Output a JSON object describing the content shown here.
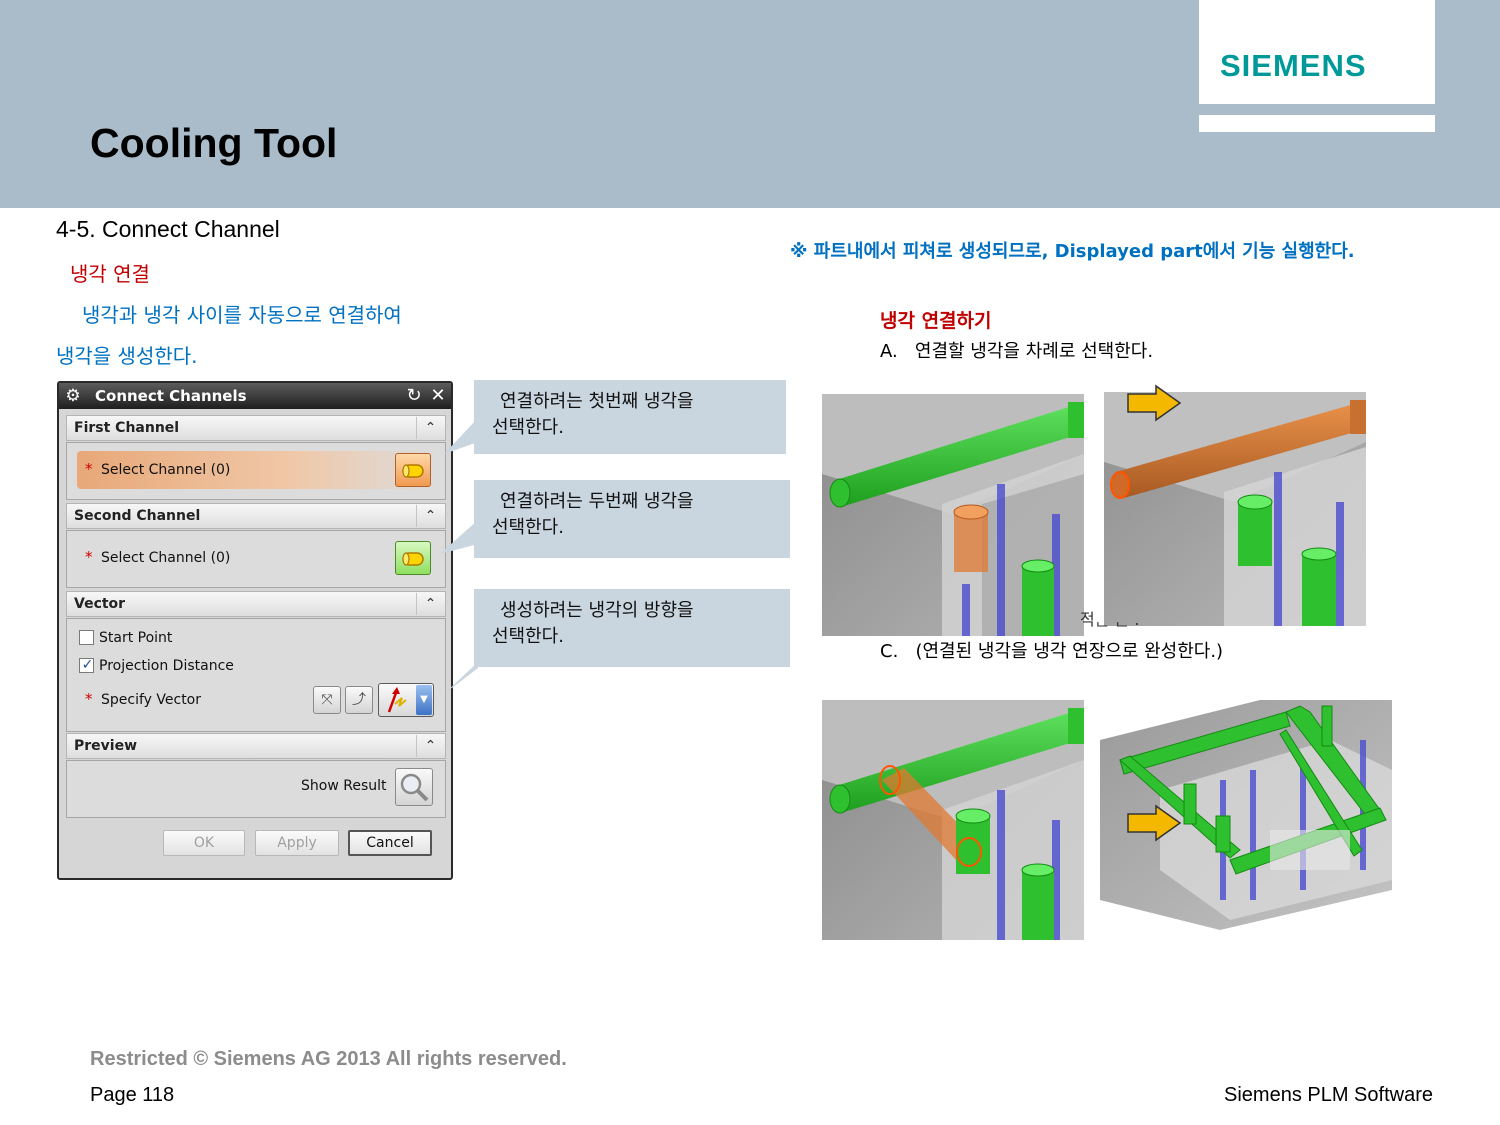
{
  "header": {
    "logo": "SIEMENS",
    "title": "Cooling Tool"
  },
  "left": {
    "section_title": "4-5.  Connect  Channel",
    "subtitle": "냉각 연결",
    "desc_line1": "냉각과 냉각 사이를 자동으로 연결하여",
    "desc_line2": "냉각을 생성한다."
  },
  "right": {
    "note": "※ 파트내에서 피쳐로 생성되므로, Displayed part에서 기능 실행한다.",
    "heading": "냉각 연결하기",
    "step_a_label": "A.",
    "step_a_text": "연결할 냉각을 차례로 선택한다.",
    "clipped_text": "적ᆫ ᆫ .",
    "step_c_label": "C.",
    "step_c_text": "(연결된 냉각을 냉각 연장으로 완성한다.)"
  },
  "dialog": {
    "title": "Connect Channels",
    "groups": {
      "first_channel": "First Channel",
      "second_channel": "Second Channel",
      "vector": "Vector",
      "preview": "Preview"
    },
    "first_select_label": "Select Channel (0)",
    "second_select_label": "Select Channel (0)",
    "start_point_label": "Start Point",
    "start_point_checked": false,
    "projection_distance_label": "Projection Distance",
    "projection_distance_checked": true,
    "specify_vector_label": "Specify Vector",
    "show_result_label": "Show Result",
    "buttons": {
      "ok": "OK",
      "apply": "Apply",
      "cancel": "Cancel"
    },
    "colors": {
      "active_row": "#e8a878",
      "channel_green": "#33cc33"
    }
  },
  "callouts": {
    "first": [
      "연결하려는 첫번째 냉각을",
      "선택한다."
    ],
    "second": [
      "연결하려는 두번째 냉각을",
      "선택한다."
    ],
    "third": [
      "생성하려는 냉각의 방향을",
      "선택한다."
    ]
  },
  "footer": {
    "copyright": "Restricted © Siemens AG 2013 All rights reserved.",
    "page": "Page 118",
    "brand": "Siemens PLM Software"
  }
}
